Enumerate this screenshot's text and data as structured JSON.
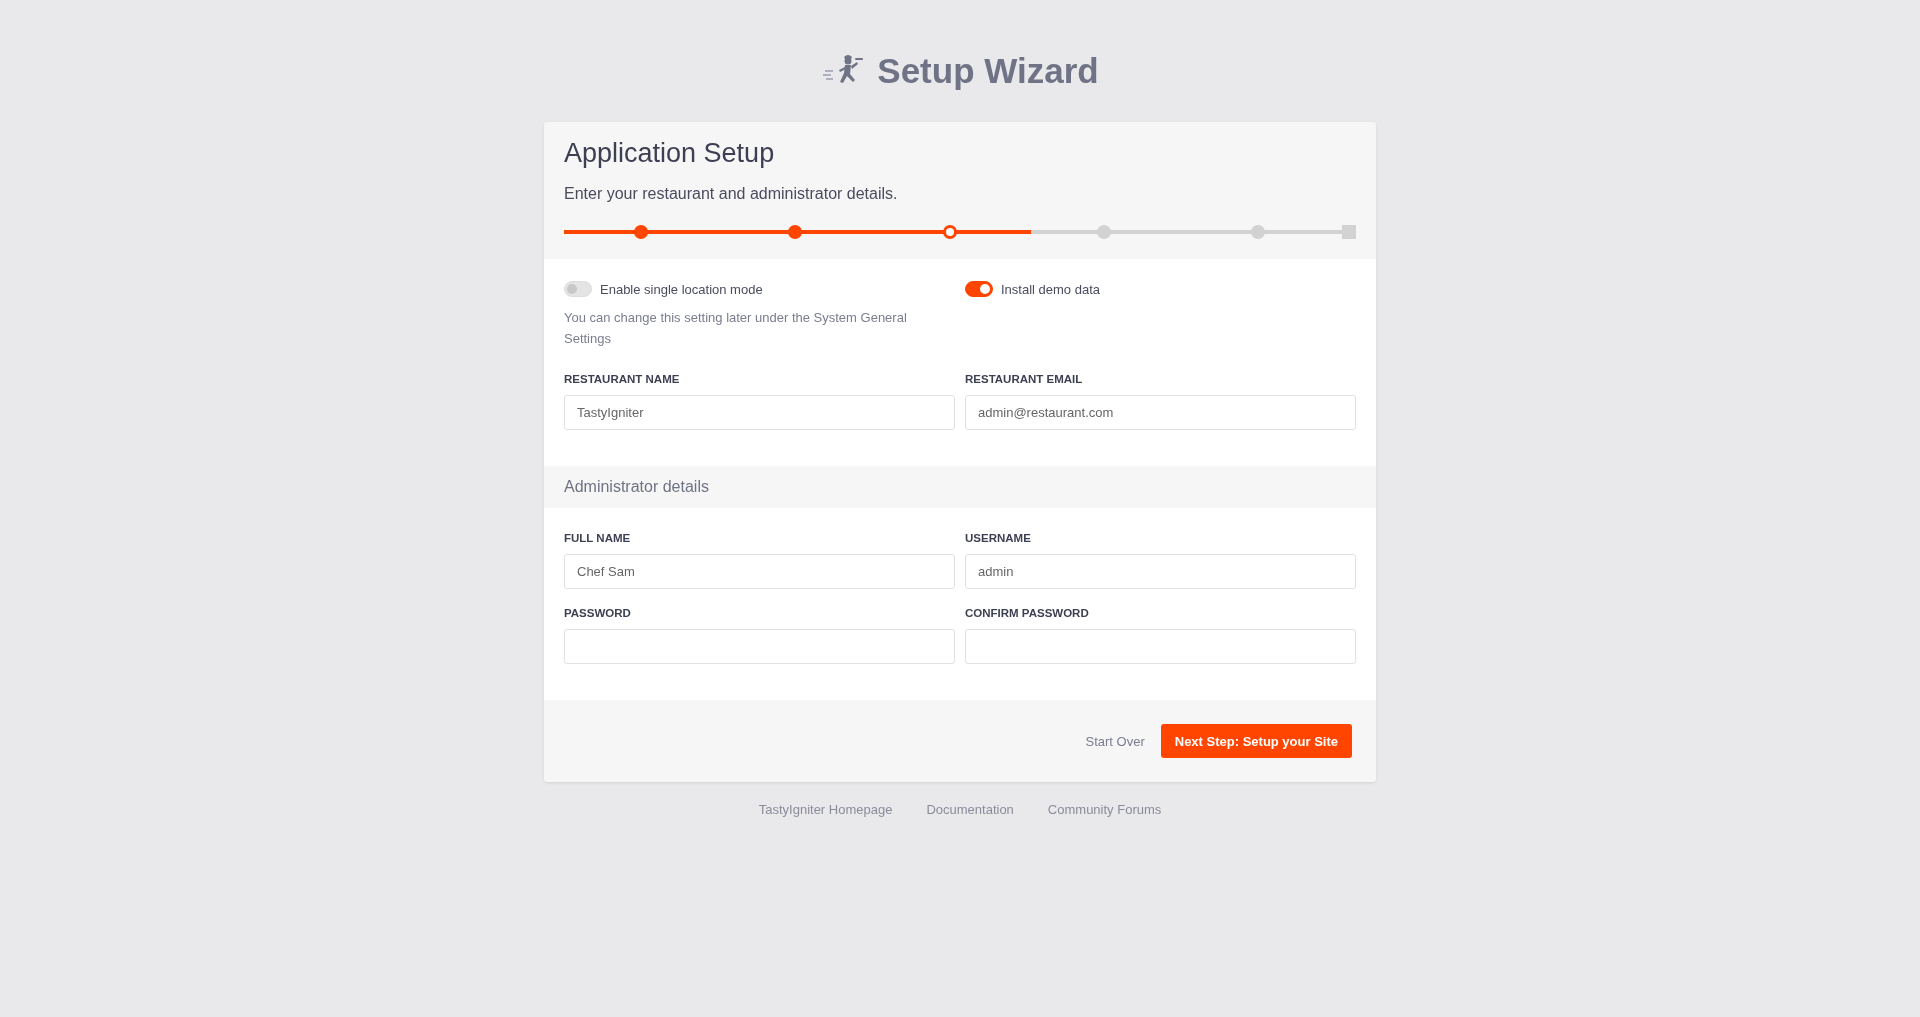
{
  "header": {
    "title": "Setup Wizard"
  },
  "card": {
    "title": "Application Setup",
    "subtitle": "Enter your restaurant and administrator details.",
    "progress": {
      "level": 0.59,
      "steps": [
        {
          "kind": "done"
        },
        {
          "kind": "done"
        },
        {
          "kind": "current"
        },
        {
          "kind": "pending"
        },
        {
          "kind": "pending"
        },
        {
          "kind": "end"
        }
      ]
    },
    "toggles": [
      {
        "label": "Enable single location mode",
        "on": false,
        "help": "You can change this setting later under the System General Settings"
      },
      {
        "label": "Install demo data",
        "on": true
      }
    ],
    "restaurant_fields": [
      {
        "label": "RESTAURANT NAME",
        "value": "TastyIgniter"
      },
      {
        "label": "RESTAURANT EMAIL",
        "value": "admin@restaurant.com"
      }
    ],
    "admin_section": {
      "title": "Administrator details",
      "fields": [
        {
          "label": "FULL NAME",
          "value": "Chef Sam"
        },
        {
          "label": "USERNAME",
          "value": "admin"
        },
        {
          "label": "PASSWORD"
        },
        {
          "label": "CONFIRM PASSWORD"
        }
      ]
    },
    "actions": {
      "secondary": "Start Over",
      "primary": "Next Step: Setup your Site"
    }
  },
  "footer_links": [
    "TastyIgniter Homepage",
    "Documentation",
    "Community Forums"
  ]
}
